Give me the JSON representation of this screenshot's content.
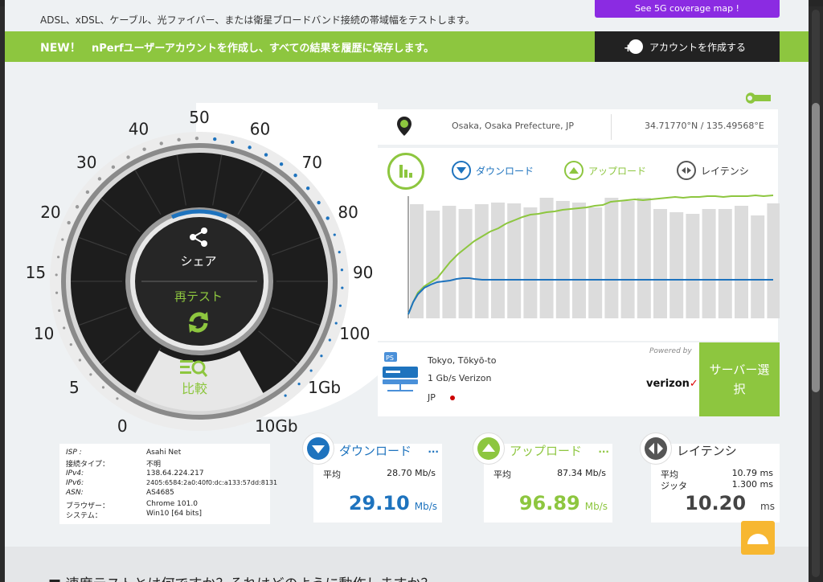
{
  "header": {
    "description": "ADSL、xDSL、ケーブル、光ファイバー、または衛星ブロードバンド接続の帯域幅をテストします。",
    "coverage_button": "See 5G coverage map !"
  },
  "newbar": {
    "badge": "NEW！",
    "text": "nPerfユーザーアカウントを作成し、すべての結果を履歴に保存します。",
    "create_account": "アカウントを作成する"
  },
  "gauge": {
    "ticks": [
      "0",
      "5",
      "10",
      "15",
      "20",
      "30",
      "40",
      "50",
      "60",
      "70",
      "80",
      "90",
      "100",
      "1Gb",
      "10Gb"
    ],
    "share_label": "シェア",
    "retest_label": "再テスト",
    "compare_label": "比較"
  },
  "location": {
    "city": "Osaka, Osaka Prefecture, JP",
    "coords": "34.71770°N / 135.49568°E"
  },
  "chart_legend": {
    "download": "ダウンロード",
    "upload": "アップロード",
    "latency": "レイテンシ"
  },
  "chart_data": {
    "type": "line",
    "series": [
      {
        "name": "ダウンロード",
        "color": "#1e73be"
      },
      {
        "name": "アップロード",
        "color": "#8dc63f"
      }
    ]
  },
  "server": {
    "city": "Tokyo, Tōkyō-to",
    "speed": "1 Gb/s Verizon",
    "country": "JP",
    "powered_by": "Powered by",
    "provider_logo": "verizon",
    "select_button": "サーバー選択"
  },
  "info": {
    "rows": [
      {
        "key": "ISP :",
        "value": "Asahi Net"
      },
      {
        "key": "接続タイプ：",
        "value": "不明"
      },
      {
        "key": "IPv4:",
        "value": "138.64.224.217"
      },
      {
        "key": "IPv6:",
        "value": "2405:6584:2a0:40f0:dc:a133:57dd:8131"
      },
      {
        "key": "ASN:",
        "value": "AS4685"
      },
      {
        "key": "ブラウザー：",
        "value": "Chrome 101.0"
      },
      {
        "key": "システム：",
        "value": "Win10 [64 bits]"
      }
    ]
  },
  "stats": {
    "download": {
      "title": "ダウンロード",
      "more": "...",
      "avg_label": "平均",
      "avg_value": "28.70 Mb/s",
      "value": "29.10",
      "unit": "Mb/s"
    },
    "upload": {
      "title": "アップロード",
      "more": "...",
      "avg_label": "平均",
      "avg_value": "87.34 Mb/s",
      "value": "96.89",
      "unit": "Mb/s"
    },
    "latency": {
      "title": "レイテンシ",
      "avg_label": "平均",
      "avg_value": "10.79 ms",
      "jitter_label": "ジッタ",
      "jitter_value": "1.300 ms",
      "value": "10.20",
      "unit": "ms"
    }
  },
  "faq": "■ 速度テストとは何ですか？それはどのように動作しますか？",
  "colors": {
    "green": "#8dc63f",
    "blue": "#1e73be",
    "dark": "#222222"
  }
}
